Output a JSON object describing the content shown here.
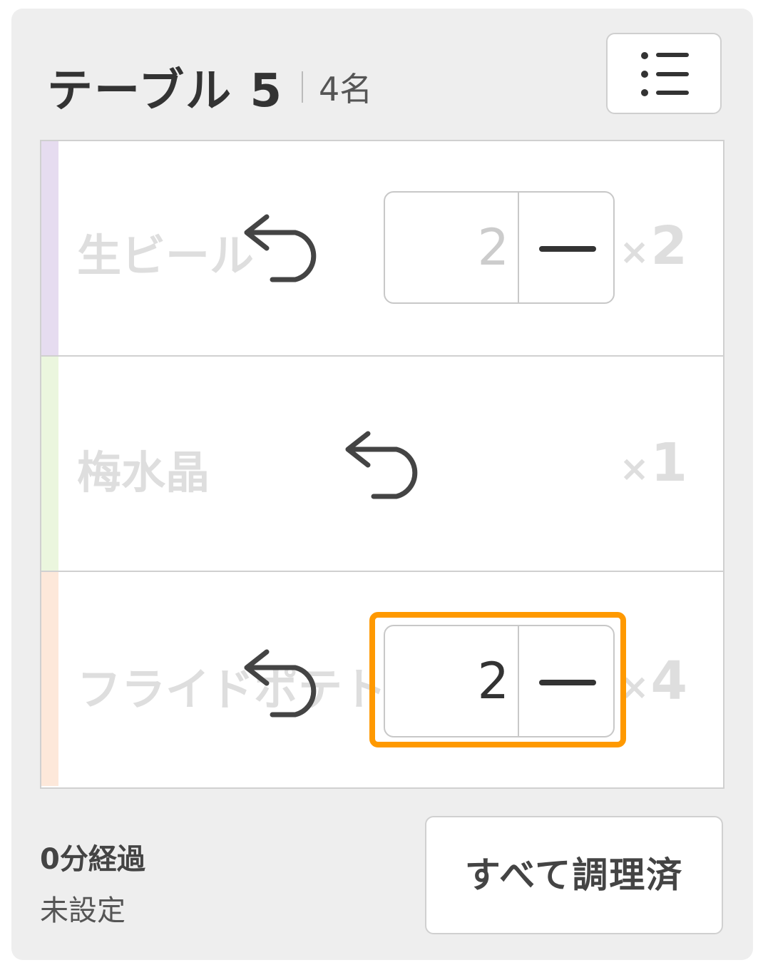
{
  "header": {
    "table_name": "テーブル 5",
    "guest_count": "4名",
    "menu_icon": "list-icon"
  },
  "orders": [
    {
      "name": "生ビール",
      "quantity": "×2",
      "stepper_value": "2",
      "stripe_color": "#e6dcf0",
      "undo_icon": "undo-icon",
      "minus_icon": "minus-icon"
    },
    {
      "name": "梅水晶",
      "quantity": "×1",
      "stripe_color": "#ebf6de",
      "undo_icon": "undo-icon"
    },
    {
      "name": "フライドポテト",
      "quantity": "×4",
      "stepper_value": "2",
      "stripe_color": "#fde8da",
      "undo_icon": "undo-icon",
      "minus_icon": "minus-icon"
    }
  ],
  "footer": {
    "elapsed": "0分経過",
    "setting": "未設定",
    "all_done_label": "すべて調理済"
  },
  "colors": {
    "highlight": "#ff9900"
  }
}
